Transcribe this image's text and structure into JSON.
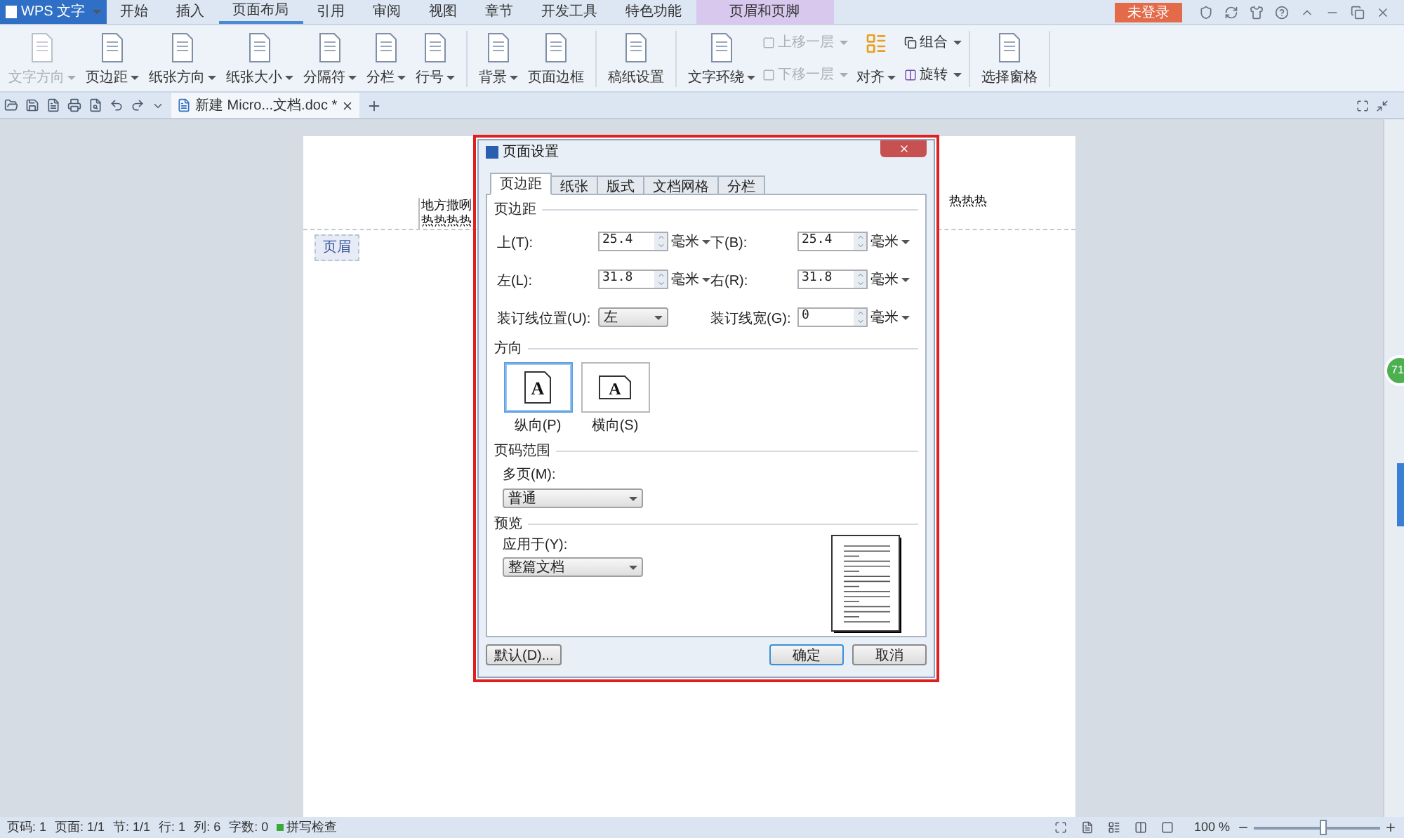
{
  "app": {
    "logo": "WPS 文字",
    "login": "未登录"
  },
  "menu_tabs": [
    {
      "label": "开始",
      "selected": false,
      "kind": "normal"
    },
    {
      "label": "插入",
      "selected": false,
      "kind": "normal"
    },
    {
      "label": "页面布局",
      "selected": true,
      "kind": "normal"
    },
    {
      "label": "引用",
      "selected": false,
      "kind": "normal"
    },
    {
      "label": "审阅",
      "selected": false,
      "kind": "normal"
    },
    {
      "label": "视图",
      "selected": false,
      "kind": "normal"
    },
    {
      "label": "章节",
      "selected": false,
      "kind": "normal"
    },
    {
      "label": "开发工具",
      "selected": false,
      "kind": "normal"
    },
    {
      "label": "特色功能",
      "selected": false,
      "kind": "normal"
    },
    {
      "label": "页眉和页脚",
      "selected": false,
      "kind": "contextual"
    }
  ],
  "ribbon_groups": [
    [
      {
        "label": "文字方向",
        "disabled": true,
        "dropdown": true
      },
      {
        "label": "页边距",
        "disabled": false,
        "dropdown": true
      },
      {
        "label": "纸张方向",
        "disabled": false,
        "dropdown": true
      },
      {
        "label": "纸张大小",
        "disabled": false,
        "dropdown": true
      },
      {
        "label": "分隔符",
        "disabled": false,
        "dropdown": true
      },
      {
        "label": "分栏",
        "disabled": false,
        "dropdown": true
      },
      {
        "label": "行号",
        "disabled": false,
        "dropdown": true
      }
    ],
    [
      {
        "label": "背景",
        "disabled": false,
        "dropdown": true
      },
      {
        "label": "页面边框",
        "disabled": false,
        "dropdown": false
      }
    ],
    [
      {
        "label": "稿纸设置",
        "disabled": false,
        "dropdown": false
      }
    ],
    [
      {
        "label": "文字环绕",
        "disabled": false,
        "dropdown": true
      }
    ],
    [
      {
        "label": "选择窗格",
        "disabled": false,
        "dropdown": false
      }
    ]
  ],
  "arrange": {
    "layer_buttons": [
      {
        "label": "上移一层",
        "disabled": true
      },
      {
        "label": "下移一层",
        "disabled": true
      }
    ],
    "align": "对齐",
    "group": "组合",
    "rotate": "旋转"
  },
  "doc_tab": "新建 Micro...文档.doc *",
  "document": {
    "header_box_lines": [
      "地方撒咧",
      "热热热热"
    ],
    "header_right": "热热热",
    "header_label": "页眉"
  },
  "floating_badge": "71",
  "dialog": {
    "title": "页面设置",
    "tabs": [
      {
        "label": "页边距",
        "selected": true
      },
      {
        "label": "纸张",
        "selected": false
      },
      {
        "label": "版式",
        "selected": false
      },
      {
        "label": "文档网格",
        "selected": false
      },
      {
        "label": "分栏",
        "selected": false
      }
    ],
    "margins_title": "页边距",
    "margin_rows": [
      [
        {
          "label": "上(T):",
          "value": "25.4",
          "unit": "毫米",
          "kind": "spin"
        },
        {
          "label": "下(B):",
          "value": "25.4",
          "unit": "毫米",
          "kind": "spin"
        }
      ],
      [
        {
          "label": "左(L):",
          "value": "31.8",
          "unit": "毫米",
          "kind": "spin"
        },
        {
          "label": "右(R):",
          "value": "31.8",
          "unit": "毫米",
          "kind": "spin"
        }
      ],
      [
        {
          "label": "装订线位置(U):",
          "value": "左",
          "kind": "select"
        },
        {
          "label": "装订线宽(G):",
          "value": "0",
          "unit": "毫米",
          "kind": "spin"
        }
      ]
    ],
    "orientation_title": "方向",
    "orientations": [
      {
        "label": "纵向(P)",
        "glyph": "A",
        "selected": true,
        "kind": "portrait"
      },
      {
        "label": "横向(S)",
        "glyph": "A",
        "selected": false,
        "kind": "landscape"
      }
    ],
    "page_range_title": "页码范围",
    "multiple_pages": {
      "label": "多页(M):",
      "value": "普通"
    },
    "preview_title": "预览",
    "apply_to": {
      "label": "应用于(Y):",
      "value": "整篇文档"
    },
    "buttons": [
      {
        "label": "默认(D)...",
        "kind": "default"
      },
      {
        "label": "确定",
        "kind": "primary"
      },
      {
        "label": "取消",
        "kind": "cancel"
      }
    ]
  },
  "status_bar": {
    "items": [
      "页码: 1",
      "页面: 1/1",
      "节: 1/1",
      "行: 1",
      "列: 6",
      "字数: 0"
    ],
    "spell_check": "拼写检查",
    "zoom": "100 %",
    "level": 0.55
  }
}
